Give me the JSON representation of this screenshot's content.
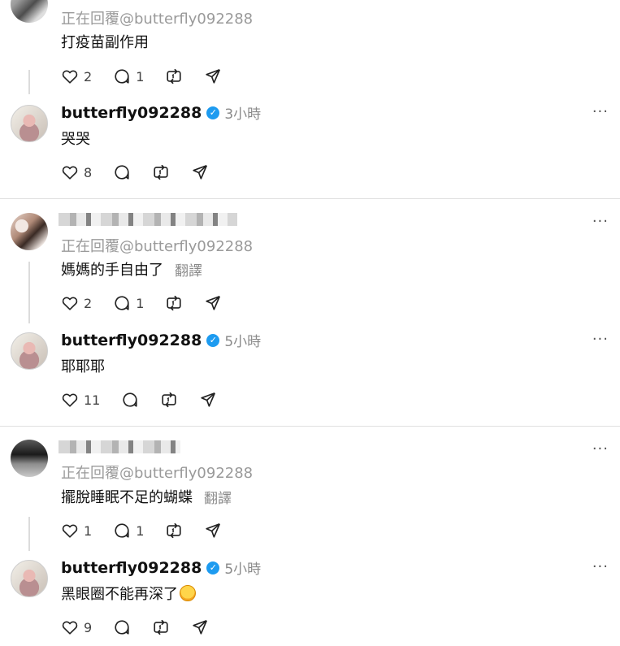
{
  "threads": [
    {
      "reply": {
        "replying_to": "正在回覆@butterfly092288",
        "text": "打疫苗副作用",
        "translate": "",
        "likes": "2",
        "comments": "1"
      },
      "author_reply": {
        "username": "butterfly092288",
        "time": "3小時",
        "text": "哭哭",
        "likes": "8",
        "comments": ""
      }
    },
    {
      "reply": {
        "replying_to": "正在回覆@butterfly092288",
        "text": "媽媽的手自由了",
        "translate": "翻譯",
        "likes": "2",
        "comments": "1"
      },
      "author_reply": {
        "username": "butterfly092288",
        "time": "5小時",
        "text": "耶耶耶",
        "likes": "11",
        "comments": ""
      }
    },
    {
      "reply": {
        "replying_to": "正在回覆@butterfly092288",
        "text": "擺脫睡眠不足的蝴蝶",
        "translate": "翻譯",
        "likes": "1",
        "comments": "1"
      },
      "author_reply": {
        "username": "butterfly092288",
        "time": "5小時",
        "text": "黑眼圈不能再深了",
        "emoji": "rolling-on-floor-laughing-emoji",
        "likes": "9",
        "comments": ""
      }
    }
  ],
  "more_label": "···",
  "verified_mark": "✓",
  "colors": {
    "verified": "#1d9bf0",
    "muted": "#9a9a9a",
    "divider": "#e0e0e0"
  }
}
